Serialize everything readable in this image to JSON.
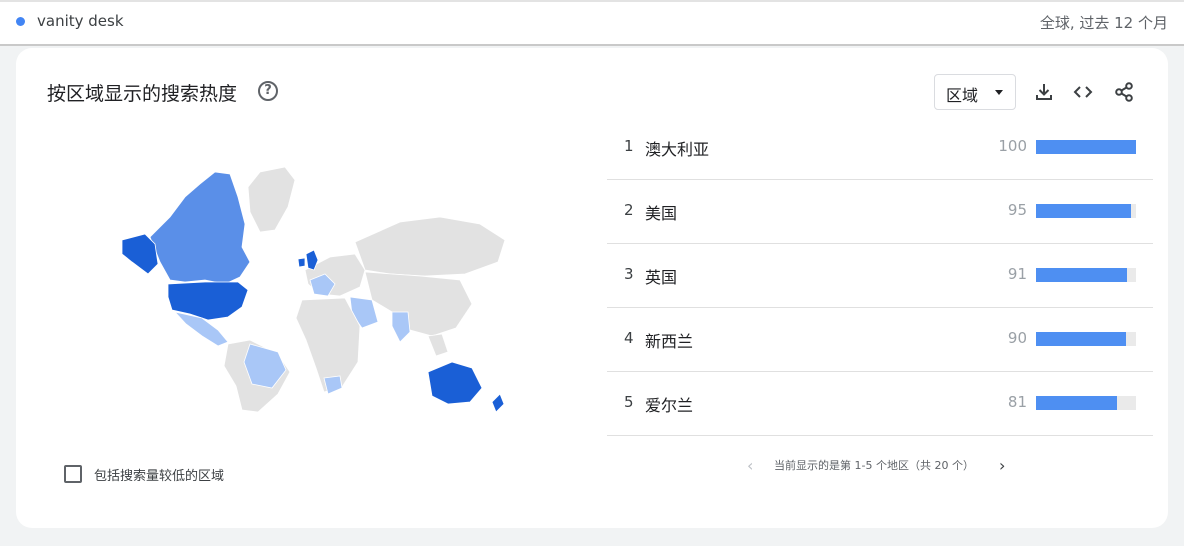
{
  "search_term": {
    "label": "vanity desk",
    "dot_color": "#4285f4",
    "scope": "全球, 过去 12 个月"
  },
  "card": {
    "title": "按区域显示的搜索热度",
    "help_icon": "?",
    "resolution_select": {
      "value": "区域"
    },
    "toolbar": [
      "download-icon",
      "embed-code-icon",
      "share-icon"
    ]
  },
  "regions": [
    {
      "rank": "1",
      "name": "澳大利亚",
      "score": "100",
      "value": 100
    },
    {
      "rank": "2",
      "name": "美国",
      "score": "95",
      "value": 95
    },
    {
      "rank": "3",
      "name": "英国",
      "score": "91",
      "value": 91
    },
    {
      "rank": "4",
      "name": "新西兰",
      "score": "90",
      "value": 90
    },
    {
      "rank": "5",
      "name": "爱尔兰",
      "score": "81",
      "value": 81
    }
  ],
  "low_volume": {
    "label": "包括搜索量较低的区域",
    "checked": false
  },
  "pagination": {
    "text": "当前显示的是第 1-5 个地区（共 20 个）",
    "prev_icon": "‹",
    "next_icon": "›"
  },
  "colors": {
    "bar": "#4e8ff2",
    "map_strong": "#1a5fd6",
    "map_medium": "#5a8fe8",
    "map_light": "#a9c7f7",
    "map_none": "#e2e2e2"
  }
}
